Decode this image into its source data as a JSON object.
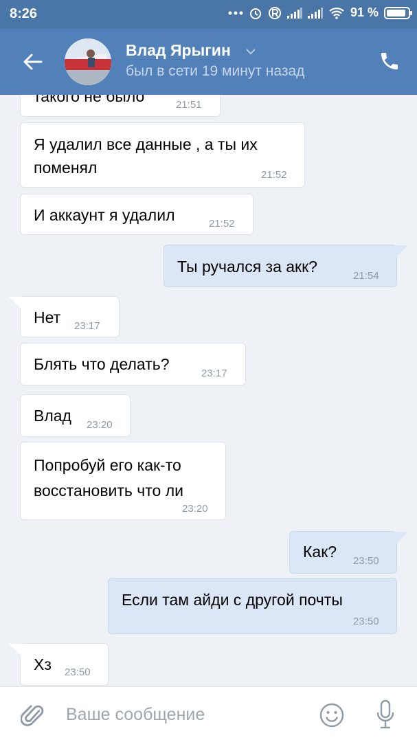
{
  "status_bar": {
    "time": "8:26",
    "battery_text": "91 %",
    "battery_level": 0.91,
    "icons": [
      "more-dots-icon",
      "alarm-icon",
      "registered-icon",
      "signal-icon",
      "signal-icon",
      "wifi-icon",
      "battery-icon"
    ]
  },
  "header": {
    "name": "Влад Ярыгин",
    "status": "был в сети 19 минут назад",
    "icons": [
      "back-arrow-icon",
      "chevron-down-icon",
      "phone-icon"
    ]
  },
  "messages": [
    {
      "dir": "in",
      "lines": [
        "такого не было"
      ],
      "time": "21:51"
    },
    {
      "dir": "in",
      "lines": [
        "Я удалил все данные , а ты их",
        "поменял"
      ],
      "time": "21:52"
    },
    {
      "dir": "in",
      "lines": [
        "И аккаунт я удалил"
      ],
      "time": "21:52"
    },
    {
      "dir": "out",
      "lines": [
        "Ты ручался за акк?"
      ],
      "time": "21:54"
    },
    {
      "dir": "in",
      "lines": [
        "Нет"
      ],
      "time": "23:17"
    },
    {
      "dir": "in",
      "lines": [
        "Блять что делать?"
      ],
      "time": "23:17"
    },
    {
      "dir": "in",
      "lines": [
        "Влад"
      ],
      "time": "23:20"
    },
    {
      "dir": "in",
      "lines": [
        "Попробуй его как-то",
        "восстановить что ли"
      ],
      "time": "23:20"
    },
    {
      "dir": "out",
      "lines": [
        "Как?"
      ],
      "time": "23:50"
    },
    {
      "dir": "out",
      "lines": [
        "Если там айди с другой почты"
      ],
      "time": "23:50"
    },
    {
      "dir": "in",
      "lines": [
        "Хз"
      ],
      "time": "23:50"
    }
  ],
  "input": {
    "placeholder": "Ваше сообщение",
    "icons": [
      "paperclip-icon",
      "smile-icon",
      "microphone-icon"
    ]
  },
  "colors": {
    "header": "#5181b8",
    "status_bar": "#4a75a7",
    "chat_bg": "#eef1f5",
    "incoming_bubble": "#ffffff",
    "outgoing_bubble": "#dbe7f6",
    "timestamp": "#8f9aa7"
  }
}
